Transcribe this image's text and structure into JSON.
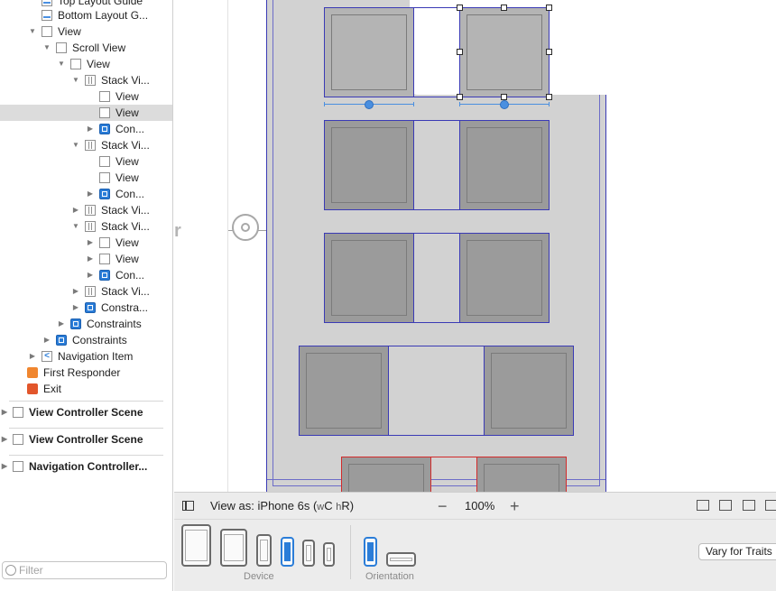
{
  "outline": {
    "items": [
      {
        "label": "Top Layout Guide",
        "icon": "guide"
      },
      {
        "label": "Bottom Layout G...",
        "icon": "guide"
      },
      {
        "label": "View",
        "icon": "view"
      },
      {
        "label": "Scroll View",
        "icon": "view"
      },
      {
        "label": "View",
        "icon": "view"
      },
      {
        "label": "Stack Vi...",
        "icon": "stack"
      },
      {
        "label": "View",
        "icon": "view"
      },
      {
        "label": "View",
        "icon": "view",
        "selected": true
      },
      {
        "label": "Con...",
        "icon": "constraints"
      },
      {
        "label": "Stack Vi...",
        "icon": "stack"
      },
      {
        "label": "View",
        "icon": "view"
      },
      {
        "label": "View",
        "icon": "view"
      },
      {
        "label": "Con...",
        "icon": "constraints"
      },
      {
        "label": "Stack Vi...",
        "icon": "stack"
      },
      {
        "label": "Stack Vi...",
        "icon": "stack"
      },
      {
        "label": "View",
        "icon": "view"
      },
      {
        "label": "View",
        "icon": "view"
      },
      {
        "label": "Con...",
        "icon": "constraints"
      },
      {
        "label": "Stack Vi...",
        "icon": "stack"
      },
      {
        "label": "Constra...",
        "icon": "constraints"
      },
      {
        "label": "Constraints",
        "icon": "constraints"
      },
      {
        "label": "Constraints",
        "icon": "constraints"
      },
      {
        "label": "Navigation Item",
        "icon": "nav-item"
      },
      {
        "label": "First Responder",
        "icon": "first-responder"
      },
      {
        "label": "Exit",
        "icon": "exit"
      }
    ],
    "scenes": [
      "View Controller Scene",
      "View Controller Scene",
      "Navigation Controller..."
    ],
    "filter_placeholder": "Filter"
  },
  "canvas": {
    "segue_arrow": "r"
  },
  "viewas": {
    "prefix": "View as: iPhone 6s (",
    "w": "w",
    "c": "C",
    "h": "h",
    "r": "R",
    "suffix": ")",
    "zoom_minus": "−",
    "zoom": "100%",
    "zoom_plus": "+"
  },
  "devices": {
    "device_label": "Device",
    "orientation_label": "Orientation",
    "vary_button": "Vary for Traits",
    "selected_device": "iPhone 6s"
  },
  "colors": {
    "accent": "#2b7dd8",
    "constraint_blue": "#3a3ab5",
    "conflict_red": "#d22b2b"
  }
}
